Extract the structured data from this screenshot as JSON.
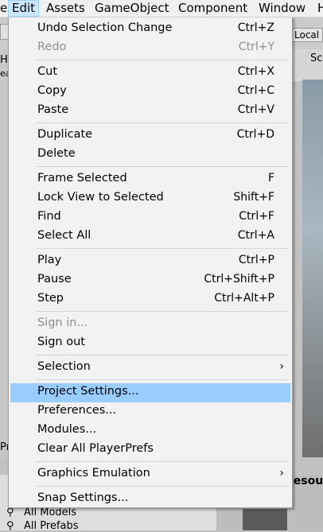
{
  "menubar": {
    "items": [
      "e",
      "Edit",
      "Assets",
      "GameObject",
      "Component",
      "Window",
      "H"
    ]
  },
  "background": {
    "local_label": "Local",
    "scene_tab": "Sc",
    "hierarchy_tab": "Hi",
    "left_fragments": [
      "ea",
      "Pr",
      "ea"
    ],
    "project_items": [
      "All Models",
      "All Prefabs"
    ],
    "resources_label": "Resour"
  },
  "menu": {
    "items": [
      {
        "label": "Undo Selection Change",
        "shortcut": "Ctrl+Z"
      },
      {
        "label": "Redo",
        "shortcut": "Ctrl+Y"
      },
      {
        "label": "Cut",
        "shortcut": "Ctrl+X"
      },
      {
        "label": "Copy",
        "shortcut": "Ctrl+C"
      },
      {
        "label": "Paste",
        "shortcut": "Ctrl+V"
      },
      {
        "label": "Duplicate",
        "shortcut": "Ctrl+D"
      },
      {
        "label": "Delete",
        "shortcut": ""
      },
      {
        "label": "Frame Selected",
        "shortcut": "F"
      },
      {
        "label": "Lock View to Selected",
        "shortcut": "Shift+F"
      },
      {
        "label": "Find",
        "shortcut": "Ctrl+F"
      },
      {
        "label": "Select All",
        "shortcut": "Ctrl+A"
      },
      {
        "label": "Play",
        "shortcut": "Ctrl+P"
      },
      {
        "label": "Pause",
        "shortcut": "Ctrl+Shift+P"
      },
      {
        "label": "Step",
        "shortcut": "Ctrl+Alt+P"
      },
      {
        "label": "Sign in...",
        "shortcut": ""
      },
      {
        "label": "Sign out",
        "shortcut": ""
      },
      {
        "label": "Selection",
        "shortcut": ""
      },
      {
        "label": "Project Settings...",
        "shortcut": ""
      },
      {
        "label": "Preferences...",
        "shortcut": ""
      },
      {
        "label": "Modules...",
        "shortcut": ""
      },
      {
        "label": "Clear All PlayerPrefs",
        "shortcut": ""
      },
      {
        "label": "Graphics Emulation",
        "shortcut": ""
      },
      {
        "label": "Snap Settings...",
        "shortcut": ""
      }
    ],
    "submenu_arrow": "›",
    "disabled_items": [
      "Redo",
      "Sign in..."
    ],
    "highlighted_item": "Project Settings...",
    "highlight_color": "#99ccff"
  }
}
